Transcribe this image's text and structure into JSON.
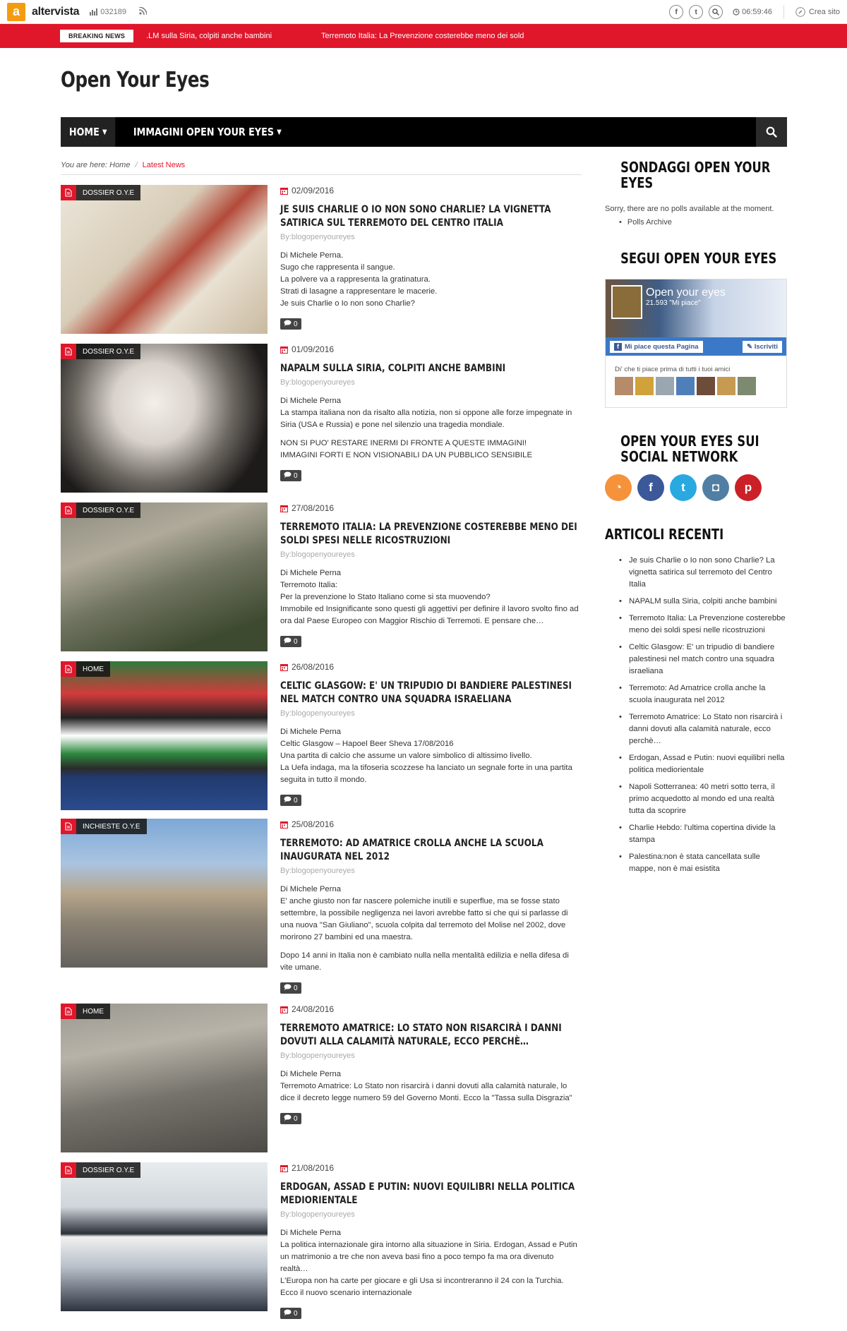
{
  "topbar": {
    "brand_letter": "a",
    "brand_name": "altervista",
    "visits": "032189",
    "time": "06:59:46",
    "create_site": "Crea sito",
    "icons": [
      "facebook-icon",
      "twitter-icon",
      "search-icon"
    ]
  },
  "breaking": {
    "label": "BREAKING NEWS",
    "items": [
      ".LM sulla Siria, colpiti anche bambini",
      "Terremoto Italia: La Prevenzione costerebbe meno dei sold"
    ]
  },
  "header": {
    "title": "Open Your Eyes"
  },
  "nav": {
    "items": [
      {
        "label": "HOME"
      },
      {
        "label": "IMMAGINI OPEN YOUR EYES"
      }
    ]
  },
  "breadcrumb": {
    "prefix": "You are here:",
    "home": "Home",
    "separator": "/",
    "current": "Latest News"
  },
  "posts": [
    {
      "category": "DOSSIER O.Y.E",
      "date": "02/09/2016",
      "title": "JE SUIS CHARLIE O IO NON SONO CHARLIE? LA VIGNETTA SATIRICA SUL TERREMOTO DEL CENTRO ITALIA",
      "by": "By:blogopenyoureyes",
      "text": [
        "Di Michele Perna.",
        "Sugo che rappresenta il sangue.",
        "La polvere va a rappresenta la gratinatura.",
        "Strati di lasagne a rappresentare le macerie.",
        "Je suis Charlie o Io non sono Charlie?"
      ],
      "comments": "0"
    },
    {
      "category": "DOSSIER O.Y.E",
      "date": "01/09/2016",
      "title": "NAPALM SULLA SIRIA, COLPITI ANCHE BAMBINI",
      "by": "By:blogopenyoureyes",
      "text": [
        "Di Michele Perna",
        "La stampa italiana non da risalto alla notizia, non si oppone alle forze impegnate in Siria (USA e Russia) e pone nel silenzio una tragedia mondiale."
      ],
      "text2": [
        "NON SI PUO' RESTARE INERMI DI FRONTE A QUESTE IMMAGINI!",
        "IMMAGINI FORTI E NON VISIONABILI DA UN PUBBLICO SENSIBILE"
      ],
      "comments": "0"
    },
    {
      "category": "DOSSIER O.Y.E",
      "date": "27/08/2016",
      "title": "TERREMOTO ITALIA: LA PREVENZIONE COSTEREBBE MENO DEI SOLDI SPESI NELLE RICOSTRUZIONI",
      "by": "By:blogopenyoureyes",
      "text": [
        "Di Michele Perna",
        "Terremoto Italia:",
        "Per la prevenzione lo Stato Italiano come si sta muovendo?",
        "Immobile ed Insignificante sono questi gli aggettivi per definire il lavoro svolto fino ad ora dal Paese Europeo con Maggior Rischio di Terremoti. E pensare che…"
      ],
      "comments": "0"
    },
    {
      "category": "HOME",
      "date": "26/08/2016",
      "title": "CELTIC GLASGOW: E' UN TRIPUDIO DI BANDIERE PALESTINESI NEL MATCH CONTRO UNA SQUADRA ISRAELIANA",
      "by": "By:blogopenyoureyes",
      "text": [
        "Di Michele Perna",
        "Celtic Glasgow – Hapoel Beer Sheva 17/08/2016",
        "Una partita di calcio che assume un valore simbolico di altissimo livello.",
        "La Uefa indaga, ma la tifoseria scozzese ha lanciato un segnale forte in una partita seguita in tutto il mondo."
      ],
      "comments": "0"
    },
    {
      "category": "INCHIESTE O.Y.E",
      "date": "25/08/2016",
      "title": "TERREMOTO: AD AMATRICE CROLLA ANCHE LA SCUOLA INAUGURATA NEL 2012",
      "by": "By:blogopenyoureyes",
      "text": [
        "Di Michele Perna",
        "E' anche giusto non far nascere polemiche inutili e superflue, ma se fosse stato settembre, la possibile negligenza nei lavori avrebbe fatto si che qui si parlasse di una nuova \"San Giuliano\", scuola colpita dal terremoto del Molise nel 2002, dove morirono 27 bambini ed una maestra."
      ],
      "text2": [
        "Dopo 14 anni in Italia non è cambiato nulla nella mentalità edilizia e nella difesa di vite umane."
      ],
      "comments": "0"
    },
    {
      "category": "HOME",
      "date": "24/08/2016",
      "title": "TERREMOTO AMATRICE: LO STATO NON RISARCIRÀ I DANNI DOVUTI ALLA CALAMITÀ NATURALE, ECCO PERCHÈ…",
      "by": "By:blogopenyoureyes",
      "text": [
        "Di Michele Perna",
        "Terremoto Amatrice: Lo Stato non risarcirà i danni dovuti alla calamità naturale, lo dice il decreto legge numero 59 del Governo Monti. Ecco la \"Tassa sulla Disgrazia\""
      ],
      "comments": "0"
    },
    {
      "category": "DOSSIER O.Y.E",
      "date": "21/08/2016",
      "title": "ERDOGAN, ASSAD E PUTIN: NUOVI EQUILIBRI NELLA POLITICA MEDIORIENTALE",
      "by": "By:blogopenyoureyes",
      "text": [
        "Di Michele Perna",
        "La politica internazionale gira intorno alla situazione in Siria. Erdogan, Assad e Putin un matrimonio a tre che non aveva basi fino a poco tempo fa ma ora divenuto realtà…",
        "L'Europa non ha carte per giocare e gli Usa si incontreranno il 24 con la Turchia. Ecco il nuovo scenario internazionale"
      ],
      "comments": "0"
    }
  ],
  "sidebar": {
    "polls": {
      "title": "SONDAGGI OPEN YOUR EYES",
      "text": "Sorry, there are no polls available at the moment.",
      "archive": "Polls Archive"
    },
    "follow": {
      "title": "SEGUI OPEN YOUR EYES",
      "page_name": "Open your eyes",
      "likes": "21.593 \"Mi piace\"",
      "like_button": "Mi piace questa Pagina",
      "subscribe_button": "Iscriviti",
      "friends_text": "Di' che ti piace prima di tutti i tuoi amici"
    },
    "social": {
      "title": "OPEN YOUR EYES SUI SOCIAL NETWORK",
      "icons": [
        {
          "name": "rss-icon",
          "glyph": "◔",
          "color": "#f5923a"
        },
        {
          "name": "facebook-icon",
          "glyph": "f",
          "color": "#3b5998"
        },
        {
          "name": "twitter-icon",
          "glyph": "t",
          "color": "#29a9e0"
        },
        {
          "name": "instagram-icon",
          "glyph": "◘",
          "color": "#517fa4"
        },
        {
          "name": "pinterest-icon",
          "glyph": "p",
          "color": "#cb2027"
        }
      ]
    },
    "recent": {
      "title": "ARTICOLI RECENTI",
      "items": [
        "Je suis Charlie o Io non sono Charlie? La vignetta satirica sul terremoto del Centro Italia",
        "NAPALM sulla Siria, colpiti anche bambini",
        "Terremoto Italia: La Prevenzione costerebbe meno dei soldi spesi nelle ricostruzioni",
        "Celtic Glasgow: E' un tripudio di bandiere palestinesi nel match contro una squadra israeliana",
        "Terremoto: Ad Amatrice crolla anche la scuola inaugurata nel 2012",
        "Terremoto Amatrice: Lo Stato non risarcirà i danni dovuti alla calamità naturale, ecco perchè…",
        "Erdogan, Assad e Putin: nuovi equilibri nella politica mediorientale",
        "Napoli Sotterranea: 40 metri sotto terra, il primo acquedotto al mondo ed una realtà tutta da scoprire",
        "Charlie Hebdo: l'ultima copertina divide la stampa",
        "Palestina:non è stata cancellata sulle mappe, non è mai esistita"
      ]
    }
  }
}
